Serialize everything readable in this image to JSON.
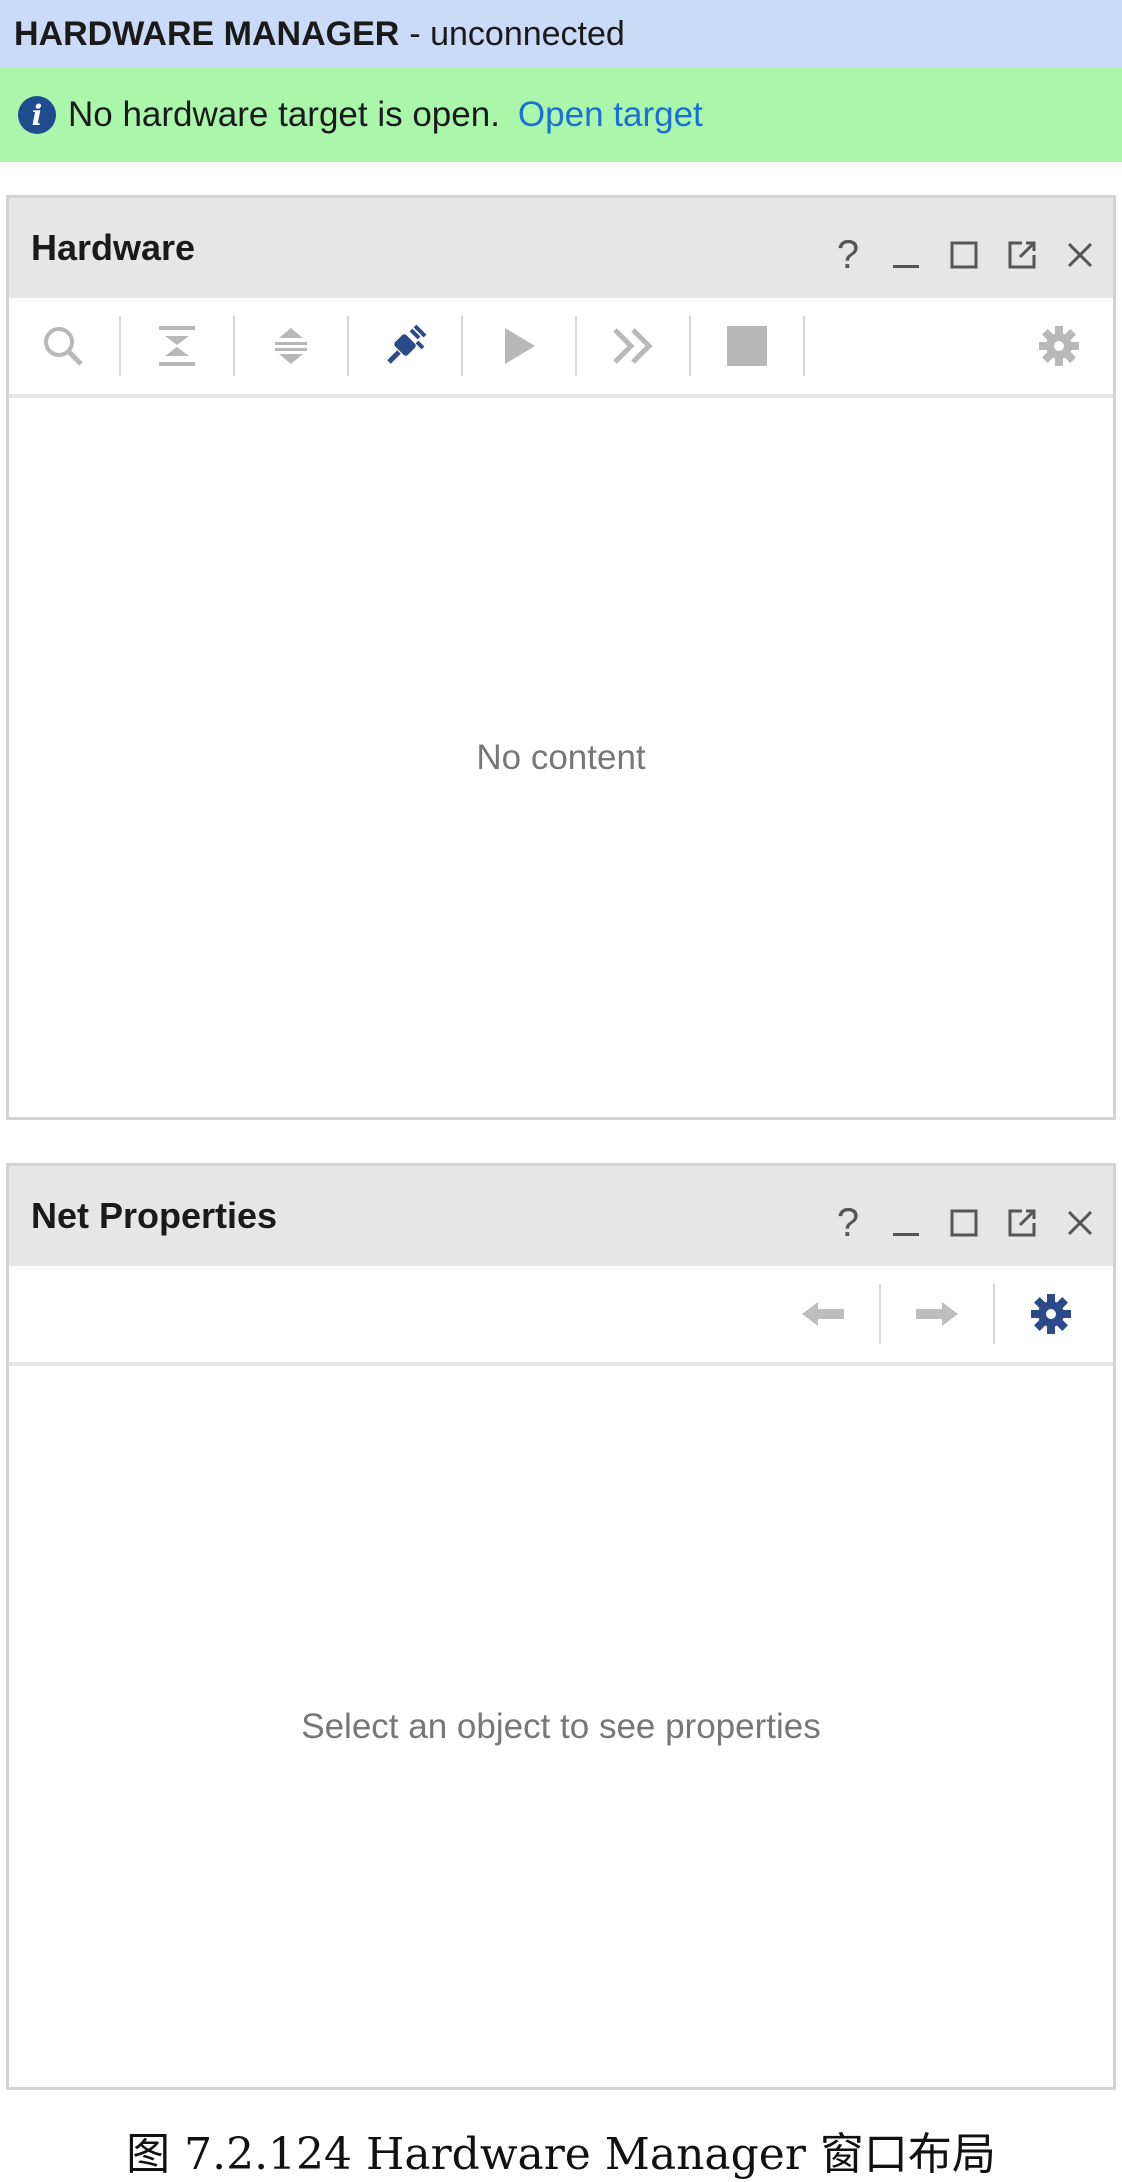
{
  "titlebar": {
    "title": "HARDWARE MANAGER",
    "status": "- unconnected"
  },
  "banner": {
    "icon": "info-icon",
    "message": "No hardware target is open.",
    "link": "Open target"
  },
  "hardware_panel": {
    "title": "Hardware",
    "controls": {
      "help": "?",
      "minimize": "minimize-icon",
      "maximize": "maximize-icon",
      "float": "float-icon",
      "close": "close-icon"
    },
    "toolbar": [
      "search-icon",
      "collapse-all-icon",
      "expand-all-icon",
      "auto-connect-icon",
      "run-trigger-icon",
      "run-trigger-immediate-icon",
      "stop-trigger-icon",
      "gear-icon"
    ],
    "empty_text": "No content"
  },
  "net_properties_panel": {
    "title": "Net Properties",
    "controls": {
      "help": "?",
      "minimize": "minimize-icon",
      "maximize": "maximize-icon",
      "float": "float-icon",
      "close": "close-icon"
    },
    "toolbar": [
      "back-arrow-icon",
      "forward-arrow-icon",
      "gear-icon"
    ],
    "empty_text": "Select an object to see properties"
  },
  "caption": "图 7.2.124 Hardware Manager 窗口布局",
  "colors": {
    "titlebar_bg": "#c9dbf7",
    "banner_bg": "#aaf7ab",
    "link": "#1c6fd6",
    "panel_header_bg": "#e6e6e6",
    "icon_blue": "#2b4a8a",
    "icon_gray": "#b8b8b8"
  }
}
